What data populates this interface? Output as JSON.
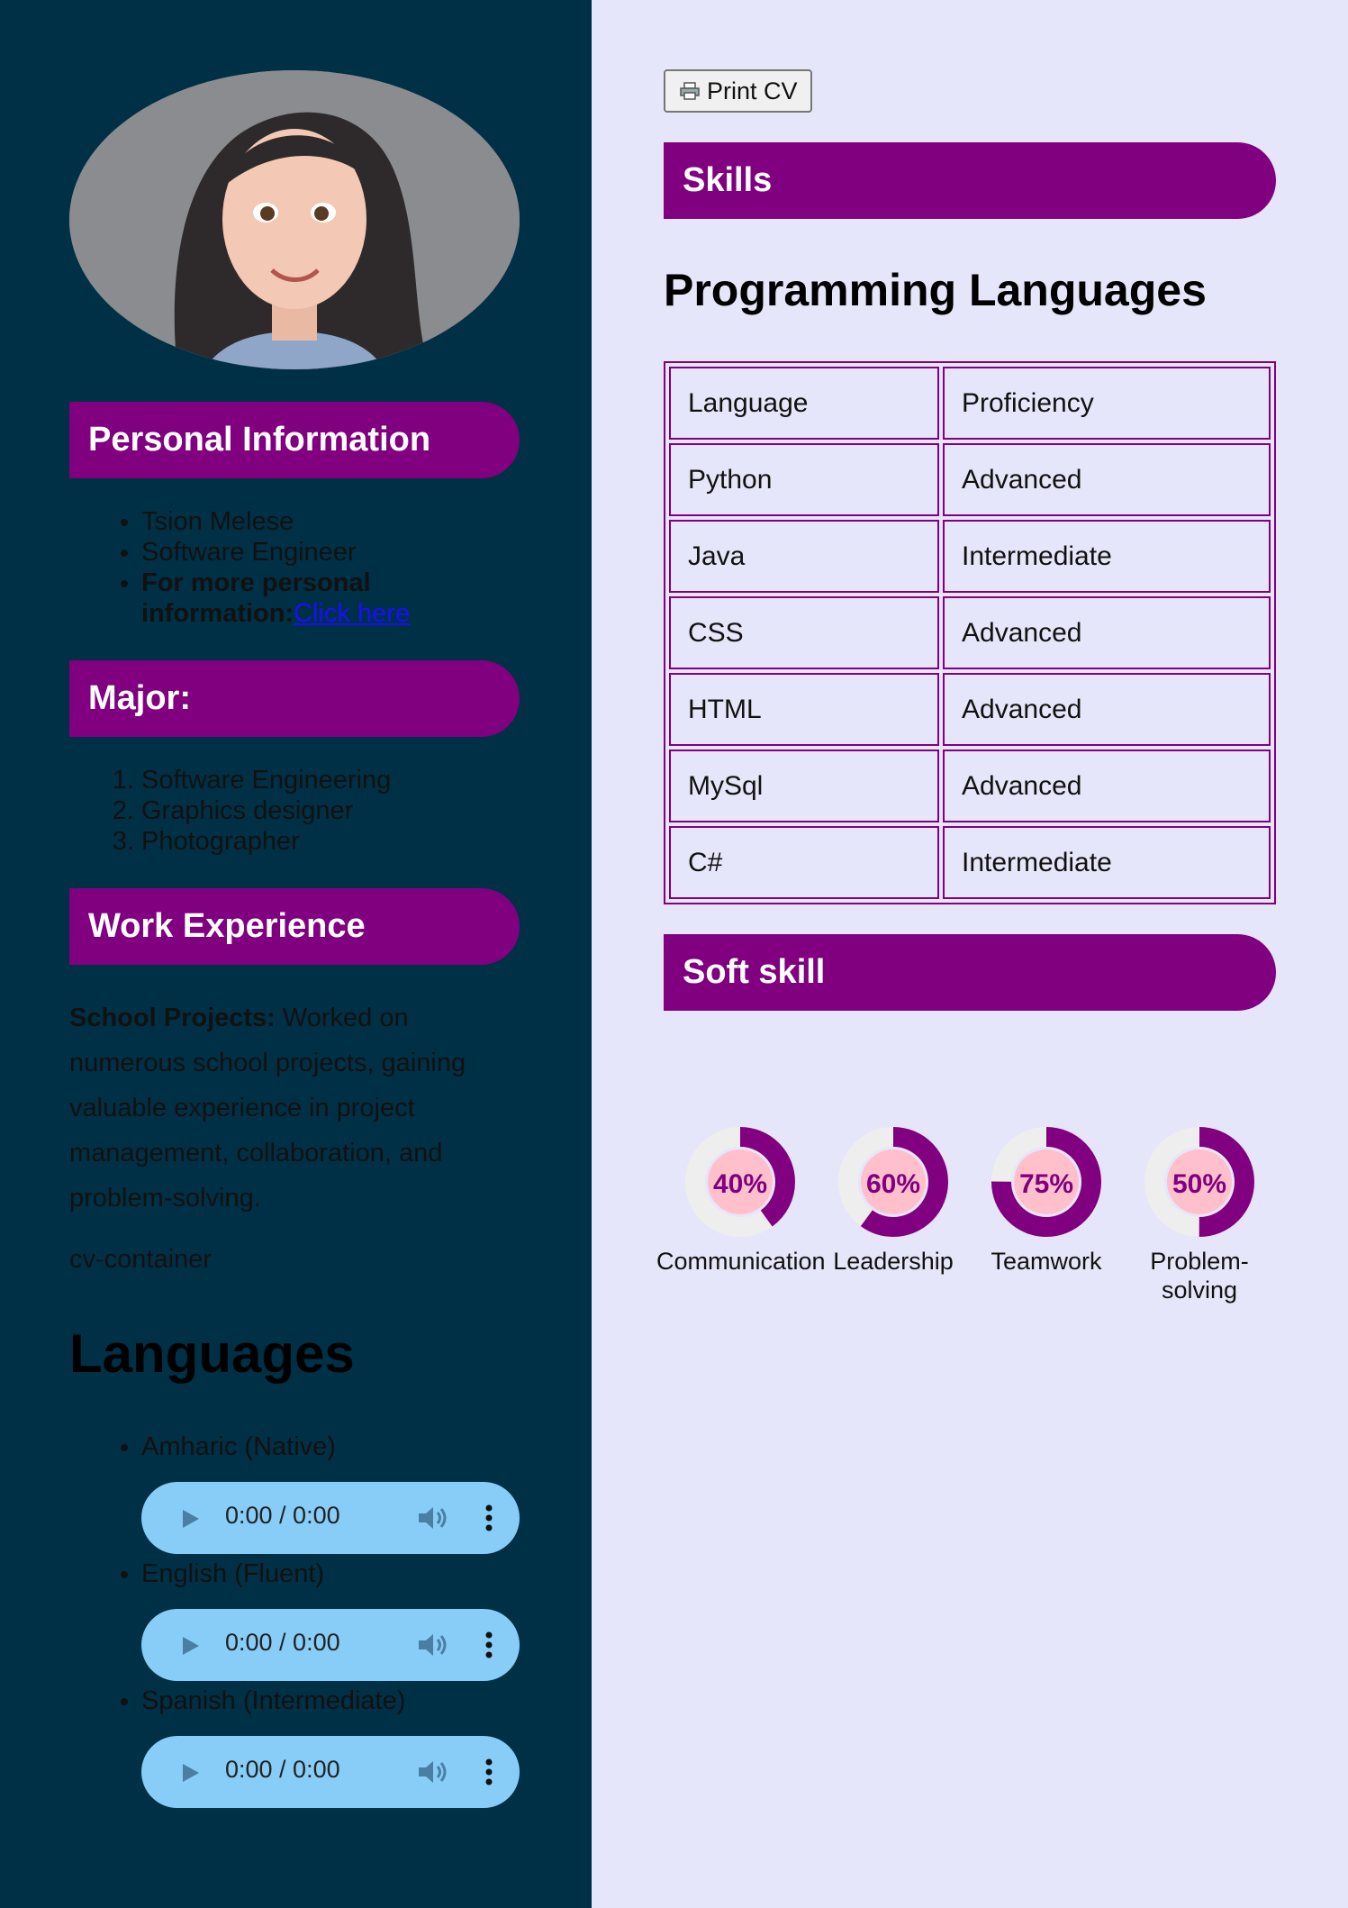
{
  "sidebar": {
    "personal_info": {
      "heading": "Personal Information",
      "name": "Tsion Melese",
      "title": "Software Engineer",
      "more_label": "For more personal information:",
      "more_link": "Click here"
    },
    "major": {
      "heading": "Major:",
      "items": [
        "Software Engineering",
        "Graphics designer",
        "Photographer"
      ]
    },
    "work": {
      "heading": "Work Experience",
      "label": "School Projects:",
      "text": " Worked on numerous school projects, gaining valuable experience in project management, collaboration, and problem-solving.",
      "container_text": "cv-container"
    },
    "languages": {
      "heading": "Languages",
      "items": [
        {
          "label": "Amharic (Native)",
          "time": "0:00 / 0:00"
        },
        {
          "label": "English (Fluent)",
          "time": "0:00 / 0:00"
        },
        {
          "label": "Spanish (Intermediate)",
          "time": "0:00 / 0:00"
        }
      ]
    }
  },
  "main": {
    "print_label": "Print CV",
    "skills_heading": "Skills",
    "prog_title": "Programming Languages",
    "table": {
      "headers": [
        "Language",
        "Proficiency"
      ],
      "rows": [
        [
          "Python",
          "Advanced"
        ],
        [
          "Java",
          "Intermediate"
        ],
        [
          "CSS",
          "Advanced"
        ],
        [
          "HTML",
          "Advanced"
        ],
        [
          "MySql",
          "Advanced"
        ],
        [
          "C#",
          "Intermediate"
        ]
      ]
    },
    "soft_heading": "Soft skill",
    "soft_skills": [
      {
        "label": "Communication",
        "percent_text": "40%",
        "value": 0.4
      },
      {
        "label": "Leadership",
        "percent_text": "60%",
        "value": 0.6
      },
      {
        "label": "Teamwork",
        "percent_text": "75%",
        "value": 0.75
      },
      {
        "label": "Problem-solving",
        "percent_text": "50%",
        "value": 0.5
      }
    ]
  },
  "colors": {
    "sidebar_bg": "#003046",
    "accent": "#800080",
    "main_bg": "#e6e6fa",
    "audio_bg": "#87cdf7",
    "gauge_inner": "#ffc0cb",
    "gauge_track": "#eeeeee"
  },
  "icons": {
    "print": "printer-icon",
    "play": "play-icon",
    "volume": "volume-icon",
    "menu": "more-vertical-icon"
  }
}
